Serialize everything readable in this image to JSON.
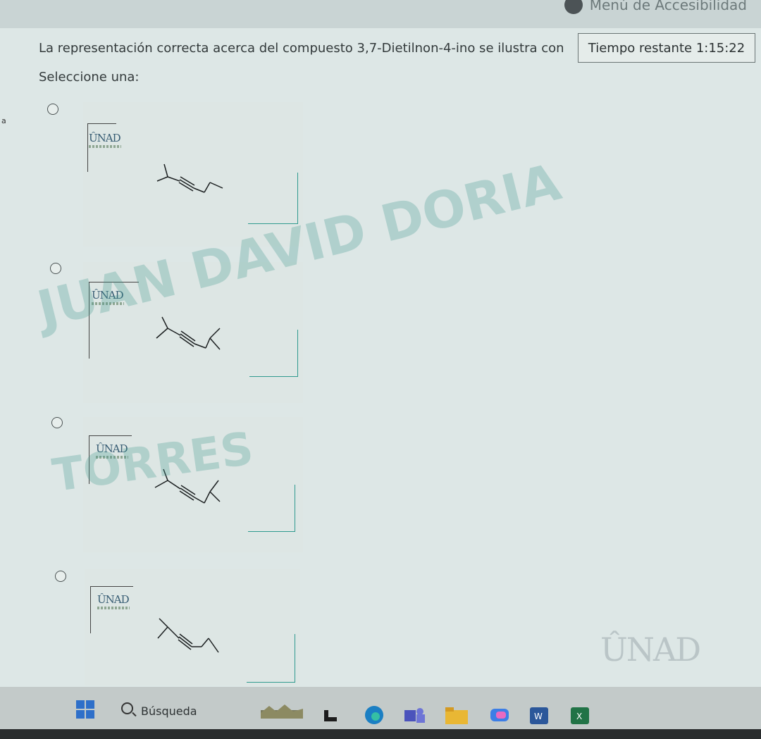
{
  "accessibility_menu": {
    "label": "Menú de Accesibilidad"
  },
  "question": {
    "text": "La representación correcta acerca del compuesto 3,7-Dietilnon-4-ino se ilustra con"
  },
  "timer": {
    "label": "Tiempo restante",
    "value": "1:15:22"
  },
  "instructions": {
    "select_one": "Seleccione una:"
  },
  "edge_letter": "a",
  "options": [
    {
      "logo": "ÛNAD"
    },
    {
      "logo": "ÛNAD"
    },
    {
      "logo": "ÛNAD"
    },
    {
      "logo": "ÛNAD"
    }
  ],
  "watermark": {
    "line1": "JUAN DAVID DORIA",
    "line2": "TORRES"
  },
  "footer_logo": "ÛNAD",
  "taskbar": {
    "search_label": "Búsqueda",
    "word_letter": "W",
    "excel_letter": "X"
  },
  "colors": {
    "page_bg": "#dde7e6",
    "teal_accent": "#2f9a8f",
    "watermark": "#3c968c"
  }
}
